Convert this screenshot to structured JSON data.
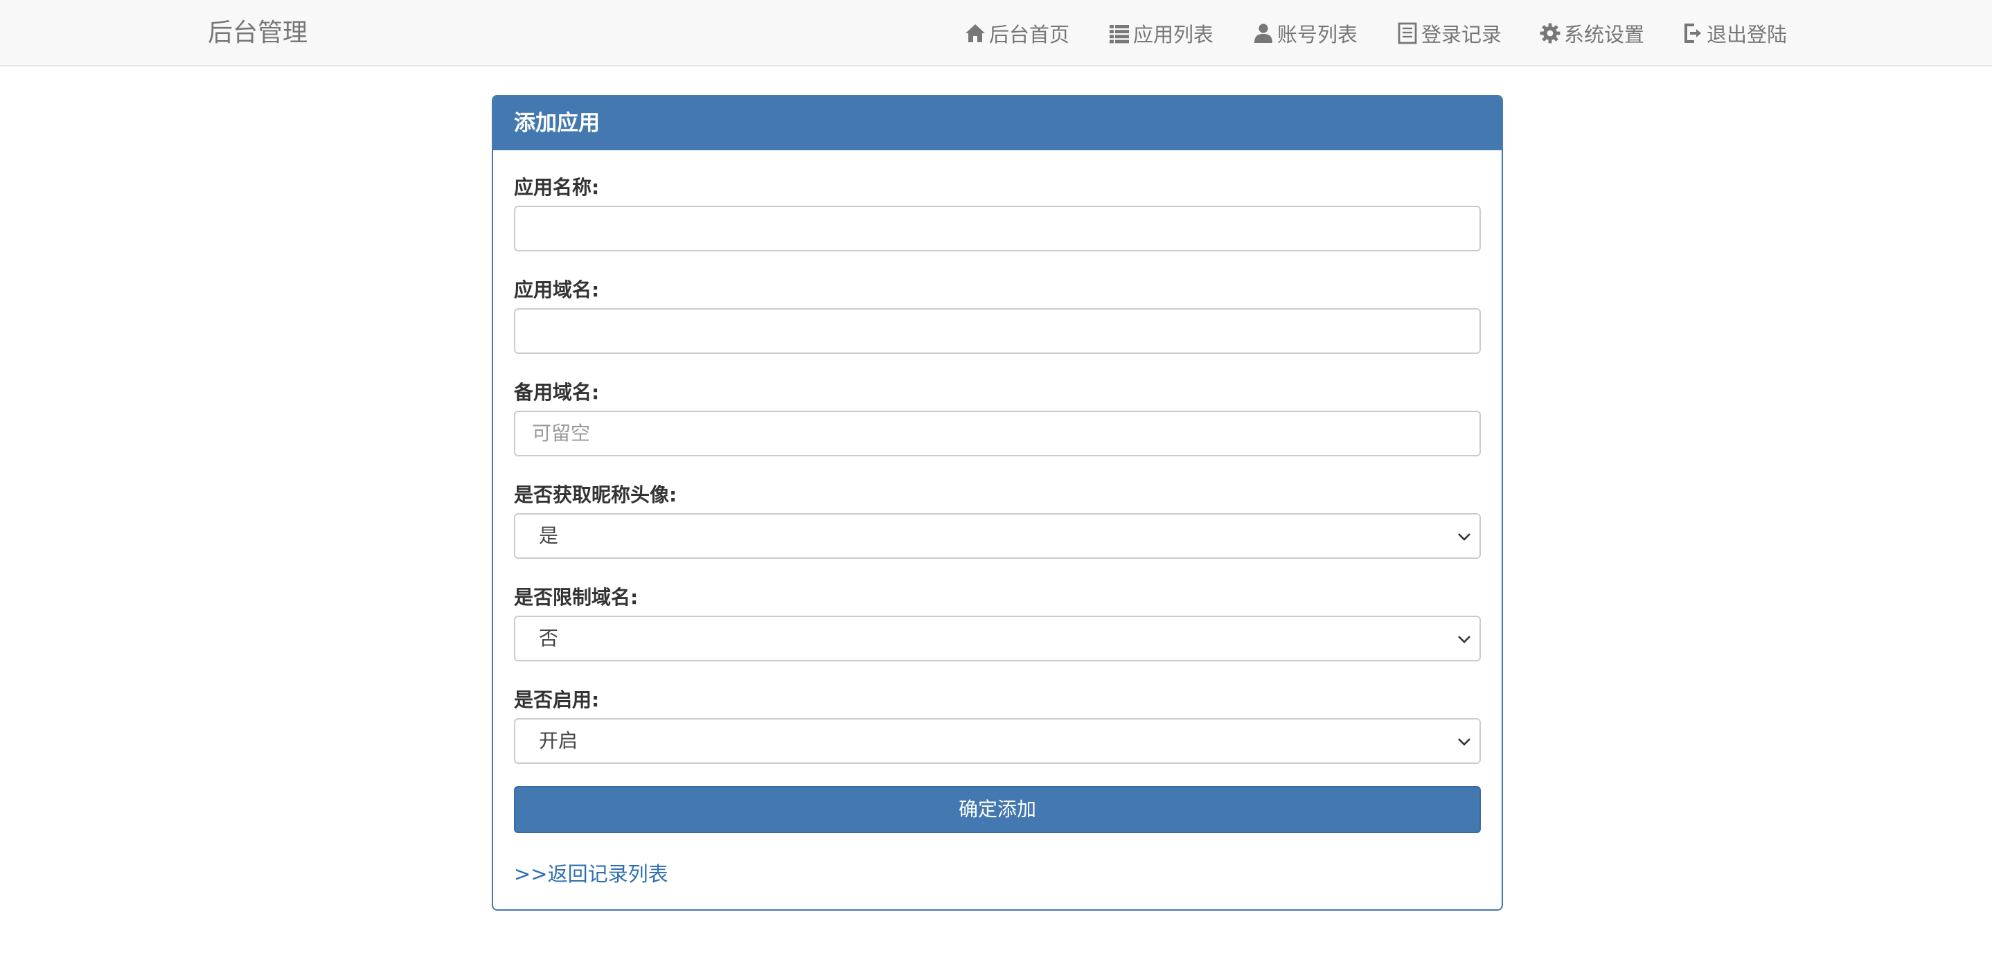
{
  "brand": "后台管理",
  "nav": [
    {
      "label": "后台首页",
      "icon": "home-icon"
    },
    {
      "label": "应用列表",
      "icon": "list-icon"
    },
    {
      "label": "账号列表",
      "icon": "user-icon"
    },
    {
      "label": "登录记录",
      "icon": "document-icon"
    },
    {
      "label": "系统设置",
      "icon": "gear-icon"
    },
    {
      "label": "退出登陆",
      "icon": "logout-icon"
    }
  ],
  "panel": {
    "title": "添加应用",
    "fields": {
      "app_name": {
        "label": "应用名称:",
        "value": "",
        "placeholder": ""
      },
      "app_domain": {
        "label": "应用域名:",
        "value": "",
        "placeholder": ""
      },
      "backup_domain": {
        "label": "备用域名:",
        "value": "",
        "placeholder": "可留空"
      },
      "get_avatar": {
        "label": "是否获取昵称头像:",
        "selected": "是"
      },
      "limit_domain": {
        "label": "是否限制域名:",
        "selected": "否"
      },
      "enabled": {
        "label": "是否启用:",
        "selected": "开启"
      }
    },
    "submit_label": "确定添加",
    "back_link": ">>返回记录列表"
  },
  "colors": {
    "primary": "#4478b0",
    "navbar_bg": "#f8f8f8",
    "nav_text": "#777777",
    "link": "#2f6fb0"
  }
}
